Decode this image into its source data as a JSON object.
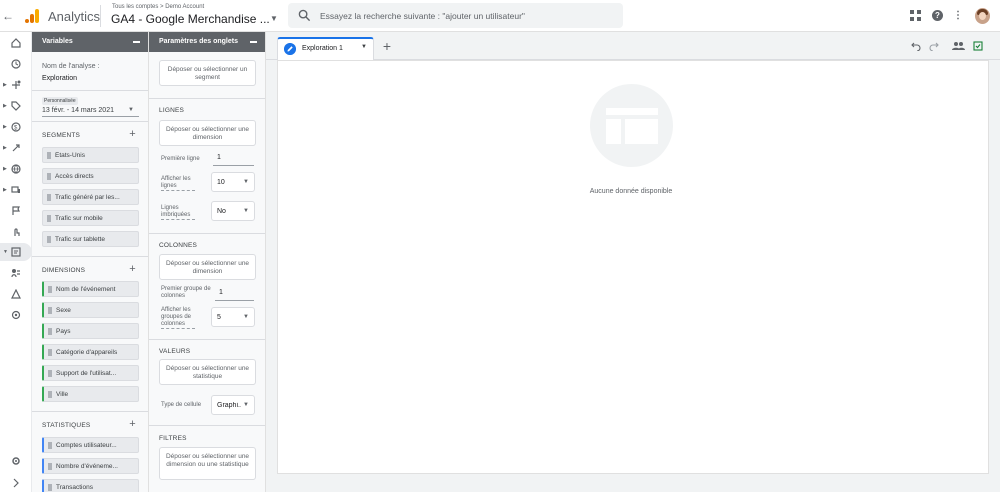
{
  "topbar": {
    "app_name": "Analytics",
    "breadcrumb": "Tous les comptes > Demo Account",
    "account_name": "GA4 - Google Merchandise ...",
    "search_placeholder": "Essayez la recherche suivante : \"ajouter un utilisateur\""
  },
  "nav": {
    "items": [
      "home",
      "reports",
      "explore",
      "advertising",
      "configure",
      "analysis",
      "realtime",
      "acquisition",
      "events",
      "engagement",
      "explore-active",
      "audience",
      "tech",
      "admin"
    ]
  },
  "variables_panel": {
    "title": "Variables",
    "analysis_name_label": "Nom de l'analyse :",
    "analysis_name": "Exploration",
    "date_type": "Personnalisée",
    "date_range": "13 févr. - 14 mars 2021",
    "segments_title": "SEGMENTS",
    "segments": [
      "États-Unis",
      "Accès directs",
      "Trafic généré par les...",
      "Trafic sur mobile",
      "Trafic sur tablette"
    ],
    "dimensions_title": "DIMENSIONS",
    "dimensions": [
      "Nom de l'événement",
      "Sexe",
      "Pays",
      "Catégorie d'appareils",
      "Support de l'utilisat...",
      "Ville"
    ],
    "metrics_title": "STATISTIQUES",
    "metrics": [
      "Comptes utilisateur...",
      "Nombre d'événeme...",
      "Transactions"
    ]
  },
  "tab_settings": {
    "title": "Paramètres des onglets",
    "segment_drop": "Déposer ou sélectionner un segment",
    "rows_title": "LIGNES",
    "rows_drop": "Déposer ou sélectionner une dimension",
    "first_row_label": "Première ligne",
    "first_row_value": "1",
    "show_rows_label": "Afficher les lignes",
    "show_rows_value": "10",
    "nested_rows_label": "Lignes imbriquées",
    "nested_rows_value": "No",
    "columns_title": "COLONNES",
    "columns_drop": "Déposer ou sélectionner une dimension",
    "first_col_group_label": "Premier groupe de colonnes",
    "first_col_group_value": "1",
    "show_col_groups_label": "Afficher les groupes de colonnes",
    "show_col_groups_value": "5",
    "values_title": "VALEURS",
    "values_drop": "Déposer ou sélectionner une statistique",
    "cell_type_label": "Type de cellule",
    "cell_type_value": "Graphi...",
    "filters_title": "FILTRES",
    "filters_drop": "Déposer ou sélectionner une dimension ou une statistique"
  },
  "canvas": {
    "tab_name": "Exploration 1",
    "empty_state": "Aucune donnée disponible"
  },
  "colors": {
    "accent": "#1a73e8",
    "dimension_chip": "#34a853",
    "metric_chip": "#4285f4",
    "panel_header": "#5f6368"
  }
}
